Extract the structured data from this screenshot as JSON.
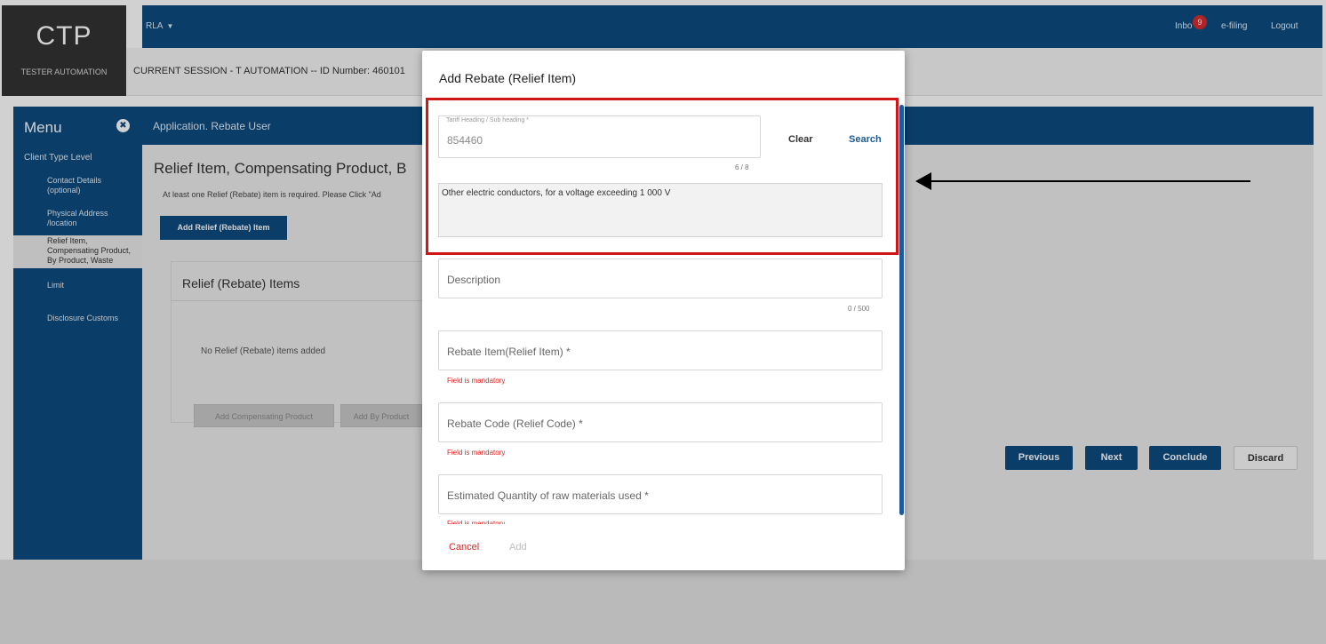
{
  "header": {
    "logo": "CTP",
    "logo_subtitle": "TESTER AUTOMATION",
    "context_dropdown": "RLA",
    "inbox_label": "Inbo",
    "inbox_count": "9",
    "efiling": "e-filing",
    "logout": "Logout"
  },
  "session": {
    "text": "CURRENT SESSION - T AUTOMATION -- ID Number: 460101"
  },
  "menu": {
    "title": "Menu",
    "items": [
      {
        "label": "Client Type Level"
      },
      {
        "label": "Contact Details (optional)"
      },
      {
        "label": "Physical Address /location"
      },
      {
        "label": "Relief Item, Compensating Product, By Product, Waste"
      },
      {
        "label": "Limit"
      },
      {
        "label": "Disclosure Customs"
      }
    ]
  },
  "main": {
    "breadcrumb": "Application. Rebate User",
    "title": "Relief Item, Compensating Product, B",
    "note": "At least one Relief (Rebate) item is required. Please Click \"Ad",
    "add_button": "Add Relief (Rebate) Item",
    "items_card": {
      "title": "Relief (Rebate) Items",
      "empty_text": "No Relief (Rebate) items added",
      "add_compensating": "Add Compensating Product",
      "add_by_product": "Add By Product"
    },
    "nav": {
      "previous": "Previous",
      "next": "Next",
      "conclude": "Conclude",
      "discard": "Discard"
    }
  },
  "modal": {
    "title": "Add Rebate (Relief Item)",
    "tariff": {
      "label": "Tariff Heading / Sub heading *",
      "value": "854460",
      "counter": "6 / 8",
      "clear": "Clear",
      "search": "Search",
      "description": "Other electric conductors, for a voltage exceeding 1 000 V"
    },
    "description": {
      "label": "Description",
      "counter": "0 / 500"
    },
    "rebate_item": {
      "label": "Rebate Item(Relief Item) *",
      "error": "Field is mandatory"
    },
    "rebate_code": {
      "label": "Rebate Code (Relief Code) *",
      "error": "Field is mandatory"
    },
    "raw_materials": {
      "label": "Estimated Quantity of raw materials used *",
      "error": "Field is mandatory"
    },
    "cancel": "Cancel",
    "add": "Add"
  },
  "colors": {
    "primary": "#0d4c81",
    "highlight": "#d01717",
    "error": "#dd2222"
  }
}
